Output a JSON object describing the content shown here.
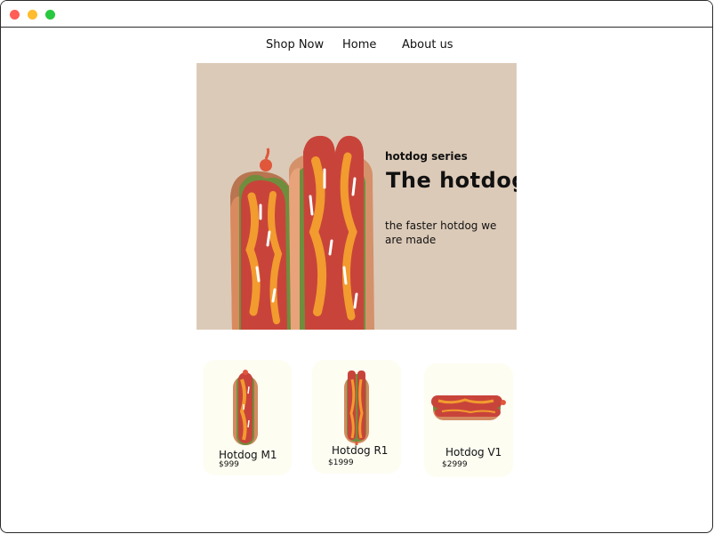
{
  "nav": {
    "items": [
      {
        "label": "Shop Now"
      },
      {
        "label": "Home"
      },
      {
        "label": "About us"
      }
    ]
  },
  "hero": {
    "eyebrow": "hotdog series",
    "title": "The hotdog",
    "description": "the faster hotdog we are made",
    "background": "#dccab8",
    "image_icon": "hotdog-pair-illustration"
  },
  "products": [
    {
      "name": "Hotdog M1",
      "price": "$999",
      "icon": "hotdog-vertical-icon"
    },
    {
      "name": "Hotdog R1",
      "price": "$1999",
      "icon": "hotdog-vertical-icon"
    },
    {
      "name": "Hotdog V1",
      "price": "$2999",
      "icon": "hotdog-horizontal-icon"
    }
  ],
  "colors": {
    "card_background": "#fdfdf2",
    "bun": "#d9875b",
    "sausage": "#c8443a",
    "mustard": "#f29b2f",
    "lettuce": "#6a8a3a"
  }
}
